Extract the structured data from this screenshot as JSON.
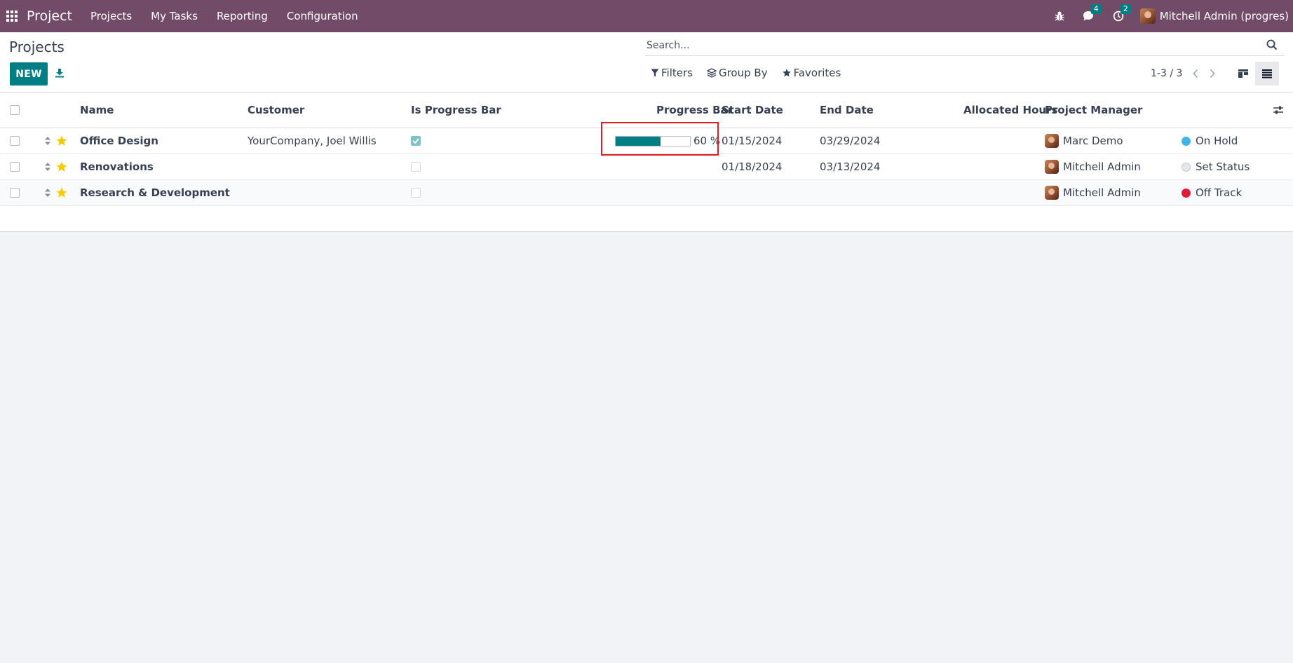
{
  "navbar": {
    "app_name": "Project",
    "menu": [
      "Projects",
      "My Tasks",
      "Reporting",
      "Configuration"
    ],
    "messages_count": "4",
    "activities_count": "2",
    "user_name": "Mitchell Admin (progres)"
  },
  "control": {
    "page_title": "Projects",
    "new_label": "NEW",
    "search_placeholder": "Search...",
    "filters_label": "Filters",
    "groupby_label": "Group By",
    "favorites_label": "Favorites",
    "pager_value": "1-3 / 3"
  },
  "columns": {
    "name": "Name",
    "customer": "Customer",
    "is_progress_bar": "Is Progress Bar",
    "progress_bar": "Progress Bar",
    "start_date": "Start Date",
    "end_date": "End Date",
    "allocated_hours": "Allocated Hours",
    "project_manager": "Project Manager"
  },
  "rows": [
    {
      "name": "Office Design",
      "customer": "YourCompany, Joel Willis",
      "is_progress_bar": true,
      "progress_value": 60,
      "progress_label": "60 %",
      "start_date": "01/15/2024",
      "end_date": "03/29/2024",
      "manager": "Marc Demo",
      "status": "On Hold",
      "status_color": "#3fb5e5",
      "favorite": true
    },
    {
      "name": "Renovations",
      "customer": "",
      "is_progress_bar": false,
      "start_date": "01/18/2024",
      "end_date": "03/13/2024",
      "manager": "Mitchell Admin",
      "status": "Set Status",
      "status_color": "#e5e7eb",
      "favorite": true
    },
    {
      "name": "Research & Development",
      "customer": "",
      "is_progress_bar": false,
      "start_date": "",
      "end_date": "",
      "manager": "Mitchell Admin",
      "status": "Off Track",
      "status_color": "#e01b3c",
      "favorite": true
    }
  ],
  "colors": {
    "navbar": "#714b67",
    "primary": "#017e84",
    "star": "#f3cc00",
    "highlight": "#e01b24"
  }
}
